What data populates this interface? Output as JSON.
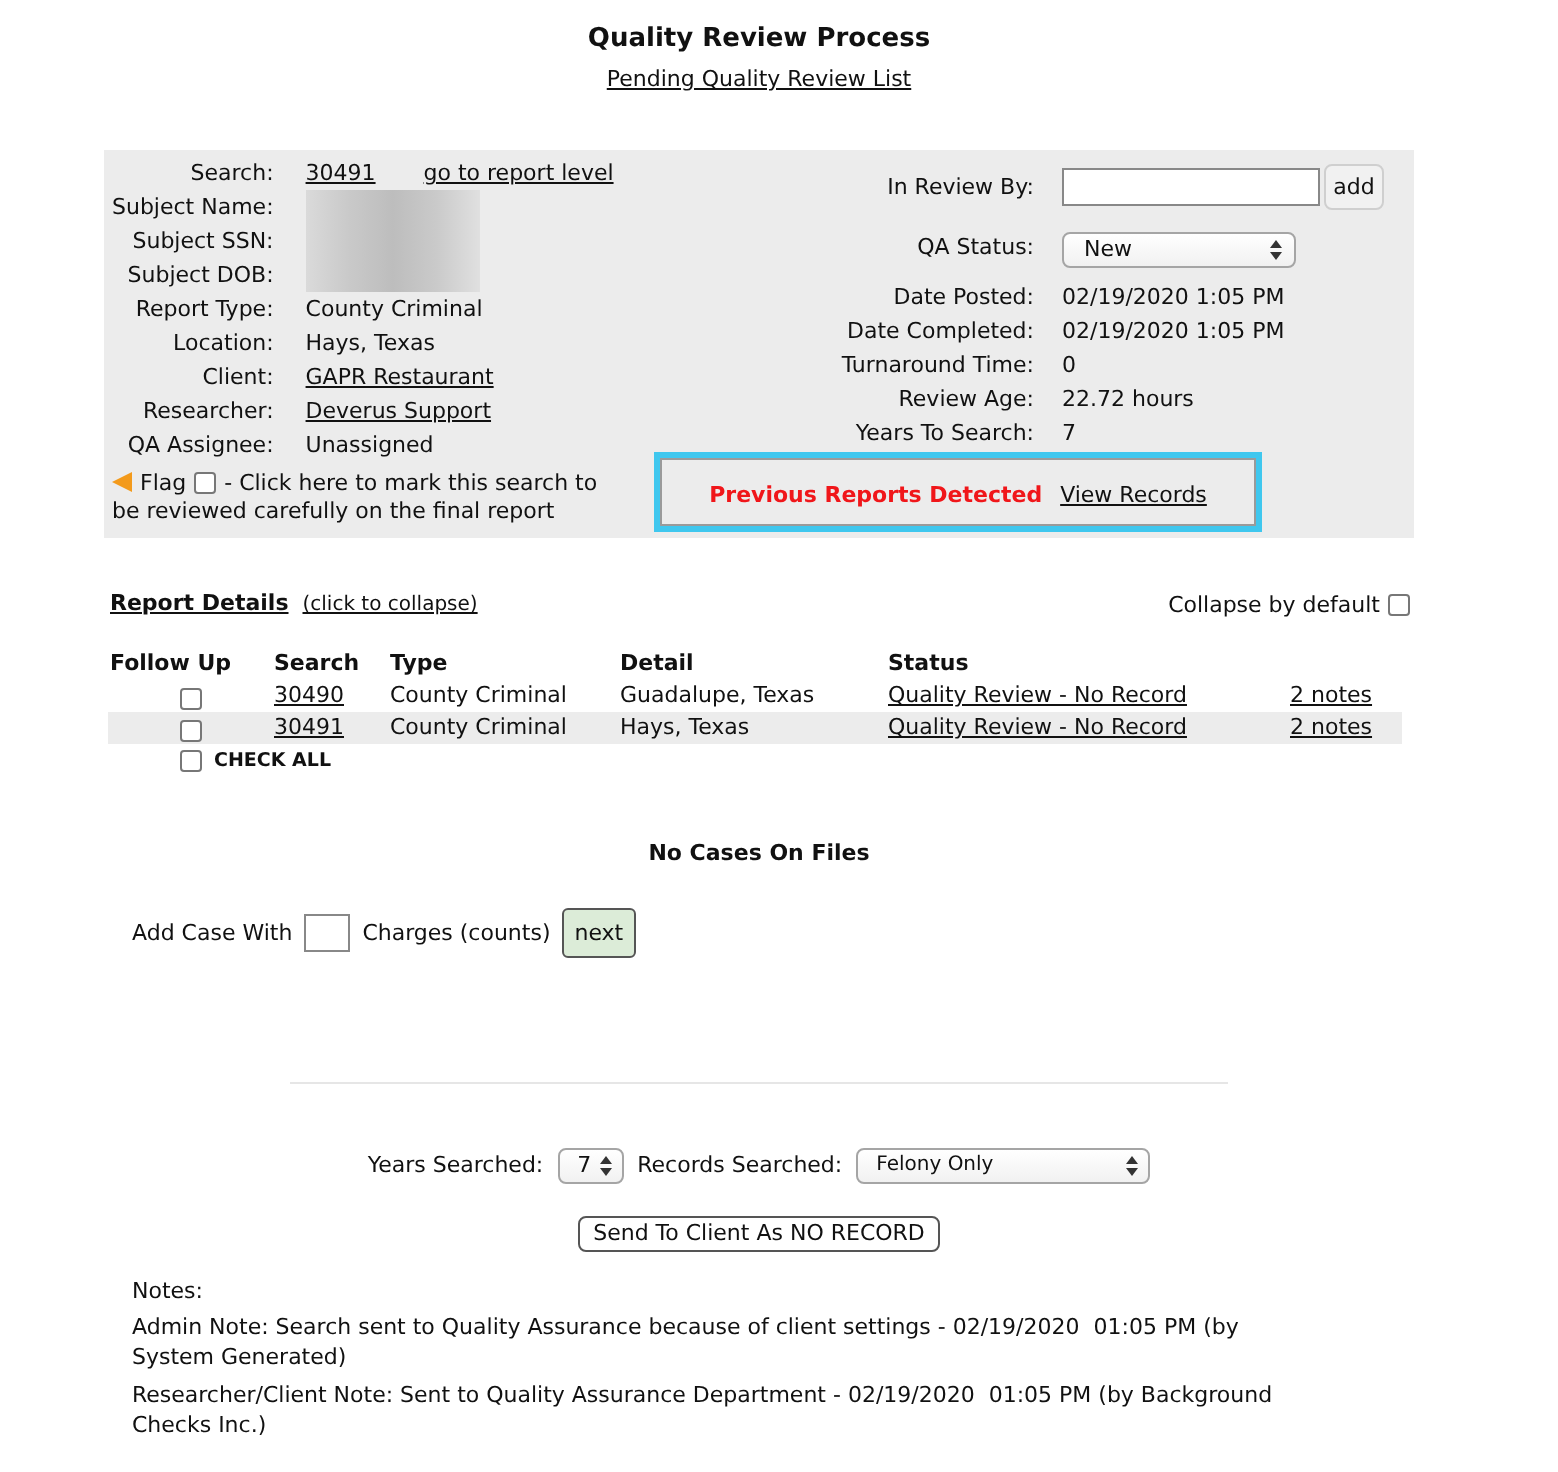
{
  "page": {
    "title": "Quality Review Process",
    "link": "Pending Quality Review List"
  },
  "summary": {
    "left_fields": [
      {
        "label": "Search:",
        "kind": "search",
        "value": "30491",
        "link": "go to report level"
      },
      {
        "label": "Subject Name:",
        "kind": "redacted"
      },
      {
        "label": "Subject SSN:",
        "kind": "redacted"
      },
      {
        "label": "Subject DOB:",
        "kind": "redacted"
      },
      {
        "label": "Report Type:",
        "kind": "text",
        "value": "County Criminal"
      },
      {
        "label": "Location:",
        "kind": "text",
        "value": "Hays, Texas"
      },
      {
        "label": "Client:",
        "kind": "link",
        "value": "GAPR Restaurant"
      },
      {
        "label": "Researcher:",
        "kind": "link",
        "value": "Deverus Support"
      },
      {
        "label": "QA Assignee:",
        "kind": "text",
        "value": "Unassigned"
      }
    ],
    "flag": {
      "label": "Flag",
      "checked": false,
      "text": "- Click here to mark this search to be reviewed carefully on the final report"
    },
    "right_fields": [
      {
        "label": "In Review By:",
        "kind": "input",
        "button": "add"
      },
      {
        "label": "QA Status:",
        "kind": "select",
        "value": "New"
      },
      {
        "label": "Date Posted:",
        "kind": "text",
        "value": "02/19/2020 1:05 PM"
      },
      {
        "label": "Date Completed:",
        "kind": "text",
        "value": "02/19/2020 1:05 PM"
      },
      {
        "label": "Turnaround Time:",
        "kind": "text",
        "value": "0"
      },
      {
        "label": "Review Age:",
        "kind": "text",
        "value": "22.72 hours"
      },
      {
        "label": "Years To Search:",
        "kind": "text",
        "value": "7"
      }
    ],
    "alert": {
      "text": "Previous Reports Detected",
      "link": "View Records"
    }
  },
  "report_details": {
    "title": "Report Details",
    "toggle": "(click to collapse)",
    "collapse_default": {
      "label": "Collapse by default",
      "checked": false
    },
    "columns": [
      "Follow Up",
      "Search",
      "Type",
      "Detail",
      "Status"
    ],
    "rows": [
      {
        "follow_up": false,
        "current": false,
        "search": "30490",
        "type": "County Criminal",
        "detail": "Guadalupe, Texas",
        "status": "Quality Review - No Record",
        "notes": "2 notes"
      },
      {
        "follow_up": false,
        "current": true,
        "search": "30491",
        "type": "County Criminal",
        "detail": "Hays, Texas",
        "status": "Quality Review - No Record",
        "notes": "2 notes"
      }
    ],
    "check_all": {
      "label": "CHECK ALL",
      "checked": false
    }
  },
  "cases": {
    "message": "No Cases On Files",
    "add_label": "Add Case With",
    "charges_label": "Charges (counts)",
    "next_button": "next"
  },
  "search_options": {
    "years_label": "Years Searched:",
    "years_value": "7",
    "records_label": "Records Searched:",
    "records_value": "Felony Only"
  },
  "send_button": "Send To Client As NO RECORD",
  "notes": {
    "title": "Notes:",
    "items": [
      "Admin Note: Search sent to Quality Assurance because of client settings - 02/19/2020  01:05 PM (by System Generated)",
      "Researcher/Client Note: Sent to Quality Assurance Department - 02/19/2020  01:05 PM (by Background Checks Inc.)"
    ]
  }
}
